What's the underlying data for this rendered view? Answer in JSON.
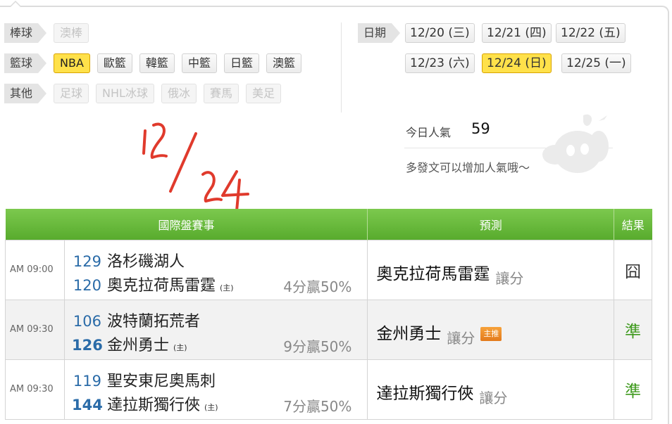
{
  "categories": [
    {
      "label": "棒球",
      "chips": [
        {
          "text": "澳棒",
          "state": "disabled"
        }
      ]
    },
    {
      "label": "籃球",
      "chips": [
        {
          "text": "NBA",
          "state": "active"
        },
        {
          "text": "歐籃",
          "state": "normal"
        },
        {
          "text": "韓籃",
          "state": "normal"
        },
        {
          "text": "中籃",
          "state": "normal"
        },
        {
          "text": "日籃",
          "state": "normal"
        },
        {
          "text": "澳籃",
          "state": "normal"
        }
      ]
    },
    {
      "label": "其他",
      "chips": [
        {
          "text": "足球",
          "state": "disabled"
        },
        {
          "text": "NHL冰球",
          "state": "disabled"
        },
        {
          "text": "俄冰",
          "state": "disabled"
        },
        {
          "text": "賽馬",
          "state": "disabled"
        },
        {
          "text": "美足",
          "state": "disabled"
        }
      ]
    }
  ],
  "dates": {
    "label": "日期",
    "items": [
      {
        "text": "12/20 (三)",
        "active": false
      },
      {
        "text": "12/21 (四)",
        "active": false
      },
      {
        "text": "12/22 (五)",
        "active": false
      },
      {
        "text": "12/23 (六)",
        "active": false
      },
      {
        "text": "12/24 (日)",
        "active": true
      },
      {
        "text": "12/25 (一)",
        "active": false
      }
    ]
  },
  "popularity": {
    "label": "今日人氣",
    "value": "59",
    "tip": "多發文可以增加人氣哦～"
  },
  "annotation": {
    "text": "12/24",
    "color": "#e03a2c"
  },
  "table": {
    "headers": {
      "match": "國際盤賽事",
      "prediction": "預測",
      "result": "結果"
    },
    "games": [
      {
        "time": "AM 09:00",
        "away": {
          "score": "129",
          "name": "洛杉磯湖人",
          "bold": false
        },
        "home": {
          "score": "120",
          "name": "奧克拉荷馬雷霆",
          "bold": false
        },
        "host_mark": "(主)",
        "odds": "4分贏50%",
        "pick": "奧克拉荷馬雷霆",
        "pick_type": "讓分",
        "badge": "",
        "result": "囧",
        "result_hit": false
      },
      {
        "time": "AM 09:30",
        "away": {
          "score": "106",
          "name": "波特蘭拓荒者",
          "bold": false
        },
        "home": {
          "score": "126",
          "name": "金州勇士",
          "bold": true
        },
        "host_mark": "(主)",
        "odds": "9分贏50%",
        "pick": "金州勇士",
        "pick_type": "讓分",
        "badge": "主推",
        "result": "準",
        "result_hit": true
      },
      {
        "time": "AM 09:30",
        "away": {
          "score": "119",
          "name": "聖安東尼奧馬刺",
          "bold": false
        },
        "home": {
          "score": "144",
          "name": "達拉斯獨行俠",
          "bold": true
        },
        "host_mark": "(主)",
        "odds": "7分贏50%",
        "pick": "達拉斯獨行俠",
        "pick_type": "讓分",
        "badge": "",
        "result": "準",
        "result_hit": true
      }
    ]
  },
  "colors": {
    "header_green": "#62b335",
    "active_yellow": "#ffe14a",
    "score_blue": "#2a6ba8",
    "hit_green": "#3f9a1e"
  }
}
